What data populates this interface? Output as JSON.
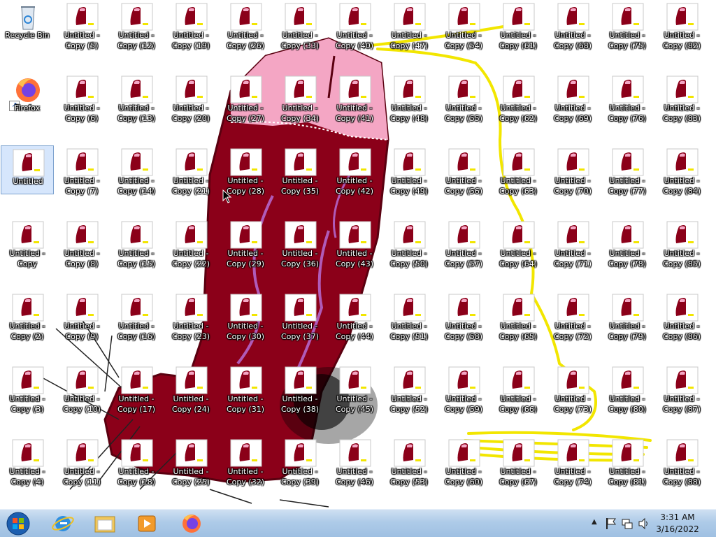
{
  "desktop": {
    "special_icons": [
      {
        "label_lines": [
          "Recycle Bin"
        ],
        "icon": "recycle-bin-icon"
      },
      {
        "label_lines": [
          "Firefox"
        ],
        "icon": "firefox-icon",
        "shortcut": true
      },
      {
        "label_lines": [
          "Untitled"
        ],
        "icon": "paint-file-icon",
        "selected": true
      },
      {
        "label_lines": [
          "Untitled -",
          "Copy"
        ],
        "icon": "paint-file-icon"
      },
      {
        "label_lines": [
          "Untitled -",
          "Copy (2)"
        ],
        "icon": "paint-file-icon"
      },
      {
        "label_lines": [
          "Untitled -",
          "Copy (3)"
        ],
        "icon": "paint-file-icon"
      },
      {
        "label_lines": [
          "Untitled -",
          "Copy (4)"
        ],
        "icon": "paint-file-icon"
      }
    ],
    "copy_label_prefix": "Untitled -",
    "copy_label_format": "Copy ({n})",
    "copy_start": 5,
    "copy_end": 88,
    "colors": {
      "drawing_body": "#8b0019",
      "drawing_tip": "#f4a6c4",
      "vein": "#b05bb8",
      "yellow_scribble": "#f2e600"
    }
  },
  "taskbar": {
    "pinned": [
      "start-orb-icon",
      "internet-explorer-icon",
      "windows-explorer-icon",
      "media-player-icon",
      "firefox-icon"
    ],
    "tray_icons": [
      "show-hidden-icons-icon",
      "action-center-flag-icon",
      "network-icon",
      "volume-icon"
    ],
    "clock": {
      "time": "3:31 AM",
      "date": "3/16/2022"
    }
  }
}
